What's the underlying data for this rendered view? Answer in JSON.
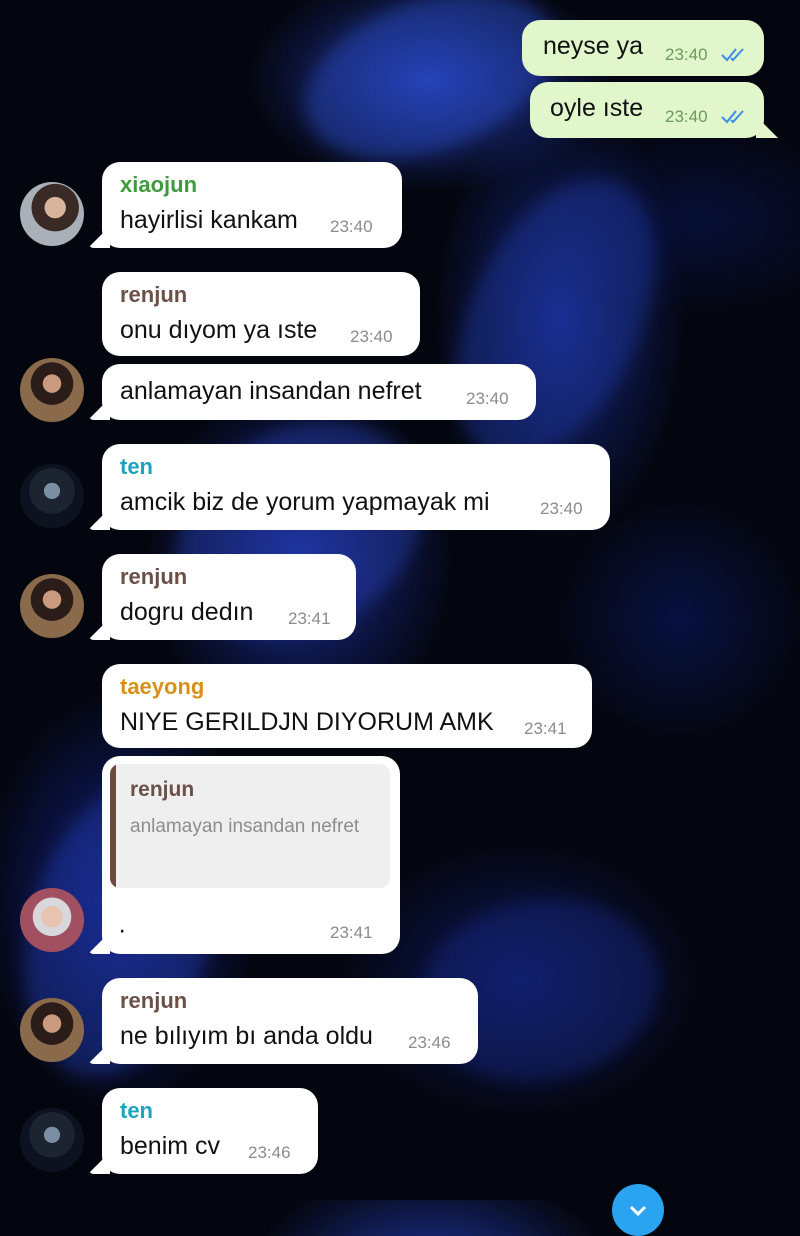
{
  "colors": {
    "incoming_bubble": "#ffffff",
    "outgoing_bubble": "#e1f7cb",
    "read_check": "#3a8ee8",
    "xiaojun": "#3e9b3e",
    "renjun": "#6b5048",
    "ten": "#1ea3bf",
    "taeyong": "#d9901a",
    "quote_bar": "#6d4a3f"
  },
  "outgoing": [
    {
      "text": "neyse ya",
      "time": "23:40",
      "status_icon": "double-check-icon"
    },
    {
      "text": "oyle ıste",
      "time": "23:40",
      "status_icon": "double-check-icon"
    }
  ],
  "incoming": [
    {
      "sender": "xiaojun",
      "text": "hayirlisi kankam",
      "time": "23:40"
    },
    {
      "sender": "renjun",
      "text": "onu dıyom ya ıste",
      "time": "23:40"
    },
    {
      "text": "anlamayan insandan nefret",
      "time": "23:40"
    },
    {
      "sender": "ten",
      "text": "amcik biz de yorum yapmayak mi",
      "time": "23:40"
    },
    {
      "sender": "renjun",
      "text": "dogru dedın",
      "time": "23:41"
    },
    {
      "sender": "taeyong",
      "text": "NIYE GERILDJN DIYORUM AMK",
      "time": "23:41"
    },
    {
      "quote": {
        "name": "renjun",
        "text": "anlamayan insandan nefret"
      },
      "text": "·",
      "time": "23:41"
    },
    {
      "sender": "renjun",
      "text": "ne bılıyım bı anda oldu",
      "time": "23:46"
    },
    {
      "sender": "ten",
      "text": "benim cv",
      "time": "23:46"
    }
  ]
}
